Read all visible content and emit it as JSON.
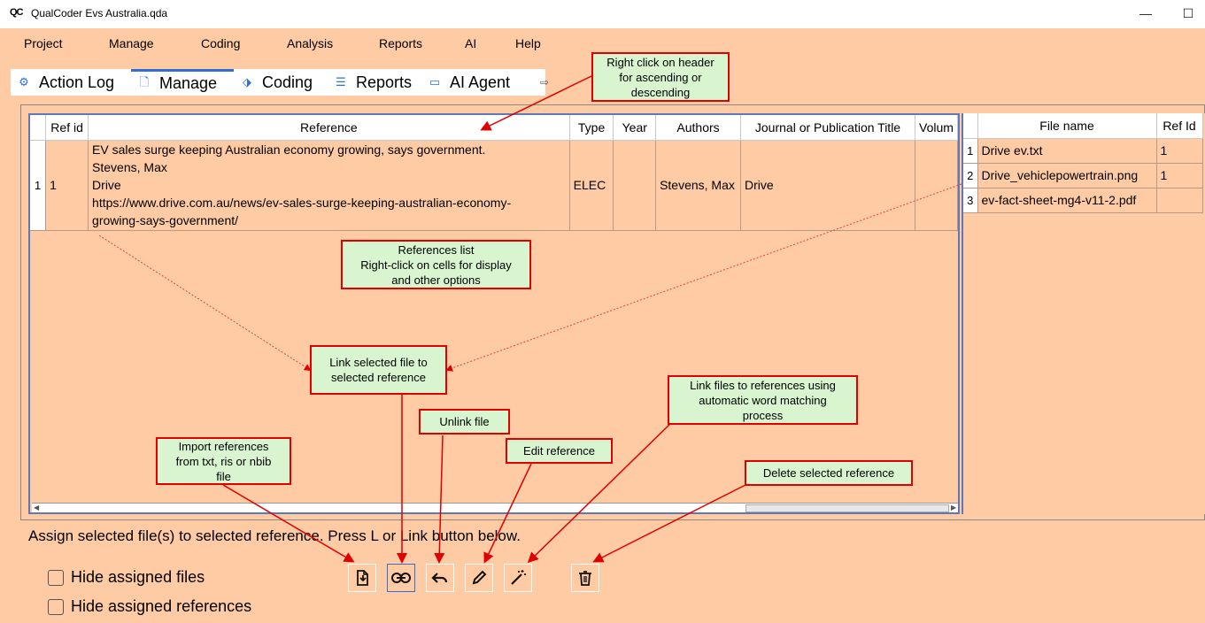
{
  "window": {
    "logo": "QC",
    "title": "QualCoder Evs Australia.qda",
    "minimize": "—",
    "maximize": "☐"
  },
  "menu": [
    "Project",
    "Manage",
    "Coding",
    "Analysis",
    "Reports",
    "AI",
    "Help"
  ],
  "tabs": [
    {
      "label": "Action Log",
      "icon": "gear-icon",
      "glyph": "⚙",
      "active": false
    },
    {
      "label": "Manage",
      "icon": "document-icon",
      "glyph": "🗋",
      "active": true
    },
    {
      "label": "Coding",
      "icon": "tag-icon",
      "glyph": "⬗",
      "active": false
    },
    {
      "label": "Reports",
      "icon": "list-icon",
      "glyph": "☰",
      "active": false
    },
    {
      "label": "AI Agent",
      "icon": "chat-icon",
      "glyph": "▭",
      "active": false
    }
  ],
  "tab_scroll": "⇨",
  "references": {
    "columns": [
      "Ref id",
      "Reference",
      "Type",
      "Year",
      "Authors",
      "Journal or Publication Title",
      "Volum"
    ],
    "rows": [
      {
        "row_number": "1",
        "ref_id": "1",
        "reference_lines": [
          "EV sales surge keeping Australian economy growing, says government.",
          "Stevens, Max",
          "Drive",
          "https://www.drive.com.au/news/ev-sales-surge-keeping-australian-economy-",
          "growing-says-government/"
        ],
        "type": "ELEC",
        "year": "",
        "authors": "Stevens, Max",
        "journal": "Drive",
        "volume": ""
      }
    ]
  },
  "files": {
    "columns": [
      "File name",
      "Ref Id"
    ],
    "rows": [
      {
        "row_number": "1",
        "name": "Drive ev.txt",
        "ref_id": "1"
      },
      {
        "row_number": "2",
        "name": "Drive_vehiclepowertrain.png",
        "ref_id": "1"
      },
      {
        "row_number": "3",
        "name": "ev-fact-sheet-mg4-v11-2.pdf",
        "ref_id": ""
      }
    ]
  },
  "status_text": "Assign selected file(s) to selected reference. Press L or Link button below.",
  "checkboxes": {
    "hide_files": "Hide assigned files",
    "hide_refs": "Hide assigned references"
  },
  "toolbar_icons": [
    "import-icon",
    "link-icon",
    "undo-icon",
    "edit-icon",
    "magic-wand-icon",
    "trash-icon"
  ],
  "callouts": {
    "header_sort": [
      "Right click on header",
      "for ascending or",
      "descending"
    ],
    "references_list": [
      "References list",
      "Right-click on cells for display",
      "and other options"
    ],
    "link_file": [
      "Link selected file to",
      "selected reference"
    ],
    "unlink": [
      "Unlink file"
    ],
    "auto_link": [
      "Link files to references using",
      "automatic word matching",
      "process"
    ],
    "import": [
      "Import references",
      "from txt, ris or nbib",
      "file"
    ],
    "edit": [
      "Edit reference"
    ],
    "delete": [
      "Delete selected reference"
    ]
  },
  "colors": {
    "background": "#ffcba4",
    "accent": "#2f6fd6",
    "callout_fill": "#d8f5d0",
    "callout_border": "#e00000"
  }
}
